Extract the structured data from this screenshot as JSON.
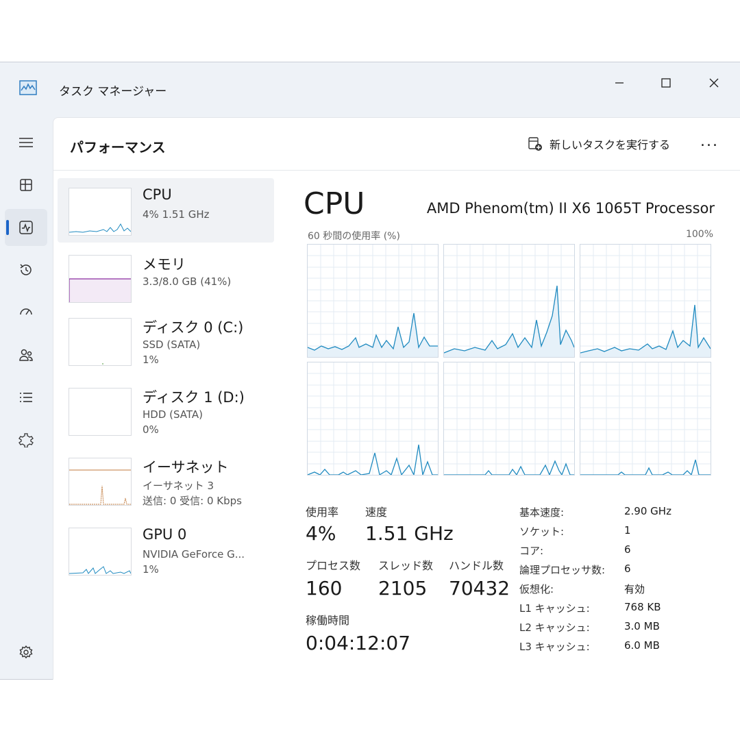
{
  "window": {
    "title": "タスク マネージャー"
  },
  "header": {
    "page_title": "パフォーマンス",
    "run_task_label": "新しいタスクを実行する",
    "more_label": "..."
  },
  "nav": {
    "items": [
      "menu-icon",
      "processes-icon",
      "performance-icon",
      "app-history-icon",
      "startup-icon",
      "users-icon",
      "details-icon",
      "services-icon",
      "settings-icon"
    ],
    "active": "performance-icon"
  },
  "resources": [
    {
      "name": "CPU",
      "line1": "4%  1.51 GHz"
    },
    {
      "name": "メモリ",
      "line1": "3.3/8.0 GB (41%)"
    },
    {
      "name": "ディスク 0 (C:)",
      "line1": "SSD (SATA)",
      "line2": "1%"
    },
    {
      "name": "ディスク 1 (D:)",
      "line1": "HDD (SATA)",
      "line2": "0%"
    },
    {
      "name": "イーサネット",
      "line1": "イーサネット 3",
      "line2": "送信: 0 受信: 0 Kbps"
    },
    {
      "name": "GPU 0",
      "line1": "NVIDIA GeForce G...",
      "line2": "1%"
    }
  ],
  "cpu": {
    "title": "CPU",
    "model": "AMD Phenom(tm) II X6 1065T Processor",
    "graph_caption": "60 秒間の使用率 (%)",
    "graph_max": "100%",
    "stats": {
      "usage_label": "使用率",
      "usage": "4%",
      "speed_label": "速度",
      "speed": "1.51 GHz",
      "processes_label": "プロセス数",
      "processes": "160",
      "threads_label": "スレッド数",
      "threads": "2105",
      "handles_label": "ハンドル数",
      "handles": "70432",
      "uptime_label": "稼働時間",
      "uptime": "0:04:12:07"
    },
    "specs": [
      {
        "k": "基本速度:",
        "v": "2.90 GHz"
      },
      {
        "k": "ソケット:",
        "v": "1"
      },
      {
        "k": "コア:",
        "v": "6"
      },
      {
        "k": "論理プロセッサ数:",
        "v": "6"
      },
      {
        "k": "仮想化:",
        "v": "有効"
      },
      {
        "k": "L1 キャッシュ:",
        "v": "768 KB"
      },
      {
        "k": "L2 キャッシュ:",
        "v": "3.0 MB"
      },
      {
        "k": "L3 キャッシュ:",
        "v": "6.0 MB"
      }
    ]
  },
  "colors": {
    "accent": "#1b64c8",
    "cpu_line": "#1f8ac0",
    "memory_line": "#8b2fa0",
    "ethernet_line": "#c07a3c"
  }
}
